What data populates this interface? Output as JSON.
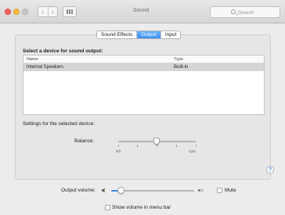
{
  "window": {
    "title": "Sound"
  },
  "search": {
    "placeholder": "Search"
  },
  "tabs": [
    {
      "label": "Sound Effects",
      "active": false
    },
    {
      "label": "Output",
      "active": true
    },
    {
      "label": "Input",
      "active": false
    }
  ],
  "output": {
    "section_label": "Select a device for sound output:",
    "columns": {
      "name": "Name",
      "type": "Type"
    },
    "devices": [
      {
        "name": "Internal Speakers",
        "type": "Built-in",
        "selected": true
      }
    ]
  },
  "settings": {
    "label": "Settings for the selected device:",
    "balance_label": "Balance:",
    "balance_left": "left",
    "balance_right": "right",
    "balance_value": 0.5
  },
  "volume": {
    "label": "Output volume:",
    "level": 0.12,
    "mute_label": "Mute",
    "muted": false,
    "menu_bar_label": "Show volume in menu bar",
    "show_in_menu_bar": false
  },
  "help": {
    "glyph": "?"
  },
  "icons": {
    "close": "close-icon",
    "minimize": "minimize-icon",
    "zoom": "zoom-icon",
    "back": "chevron-left-icon",
    "forward": "chevron-right-icon",
    "grid": "grid-icon",
    "search": "search-icon",
    "speaker_low": "speaker-low-icon",
    "speaker_high": "speaker-high-icon"
  },
  "colors": {
    "accent": "#3b8ff6",
    "close": "#fc605c",
    "minimize": "#fdbc40",
    "selected_row": "#d5d5d5"
  }
}
